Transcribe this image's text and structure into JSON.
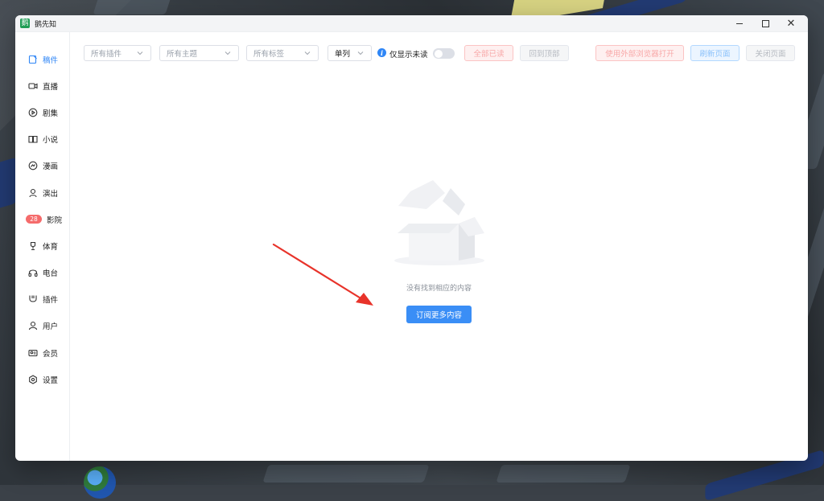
{
  "window": {
    "title": "鹅先知"
  },
  "sidebar": {
    "items": [
      {
        "label": "稿件",
        "icon": "document-icon",
        "active": true
      },
      {
        "label": "直播",
        "icon": "video-camera-icon"
      },
      {
        "label": "剧集",
        "icon": "play-circle-icon"
      },
      {
        "label": "小说",
        "icon": "book-icon"
      },
      {
        "label": "漫画",
        "icon": "comic-icon"
      },
      {
        "label": "演出",
        "icon": "performer-icon"
      },
      {
        "label": "影院",
        "icon": "cinema-icon",
        "badge": "28"
      },
      {
        "label": "体育",
        "icon": "trophy-icon"
      },
      {
        "label": "电台",
        "icon": "headphones-icon"
      },
      {
        "label": "插件",
        "icon": "plugin-icon"
      },
      {
        "label": "用户",
        "icon": "user-icon"
      },
      {
        "label": "会员",
        "icon": "membership-card-icon"
      },
      {
        "label": "设置",
        "icon": "gear-icon"
      }
    ]
  },
  "toolbar": {
    "filter_plugin": "所有插件",
    "filter_theme": "所有主题",
    "filter_tag": "所有标签",
    "layout": "单列",
    "unread_only_label": "仅显示未读",
    "unread_only_on": false,
    "mark_all_read": "全部已读",
    "back_to_top": "回到顶部",
    "open_external": "使用外部浏览器打开",
    "refresh_page": "刷新页面",
    "close_page": "关闭页面"
  },
  "empty_state": {
    "message": "没有找到相应的内容",
    "action_label": "订阅更多内容"
  },
  "colors": {
    "accent": "#2f86f6",
    "button_primary": "#3a8ef6",
    "badge": "#f56b6b",
    "annotation_arrow": "#e8332a"
  }
}
